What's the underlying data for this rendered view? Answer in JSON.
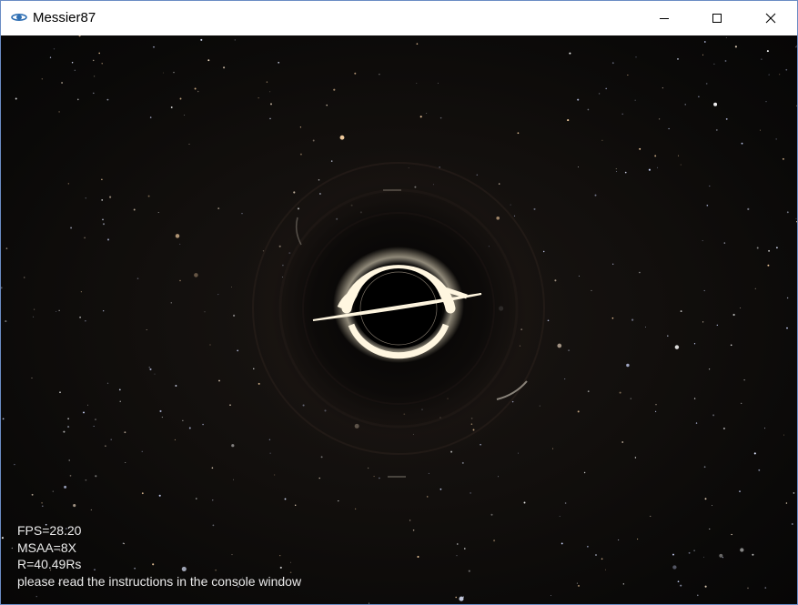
{
  "window": {
    "title": "Messier87",
    "app_icon": "galaxy-icon",
    "controls": {
      "minimize_icon": "minimize-icon",
      "maximize_icon": "maximize-icon",
      "close_icon": "close-icon"
    }
  },
  "viewport": {
    "scene": "black-hole-render",
    "hud": {
      "fps": "FPS=28.20",
      "msaa": "MSAA=8X",
      "radius": "R=40.49Rs",
      "instructions": "please read the instructions in the console window"
    }
  },
  "colors": {
    "titlebar_bg": "#ffffff",
    "window_border": "#6b8cc4",
    "space_bg": "#0d0b0a",
    "hud_text": "#eaeaea",
    "accretion_glow": "#fff6e0"
  }
}
